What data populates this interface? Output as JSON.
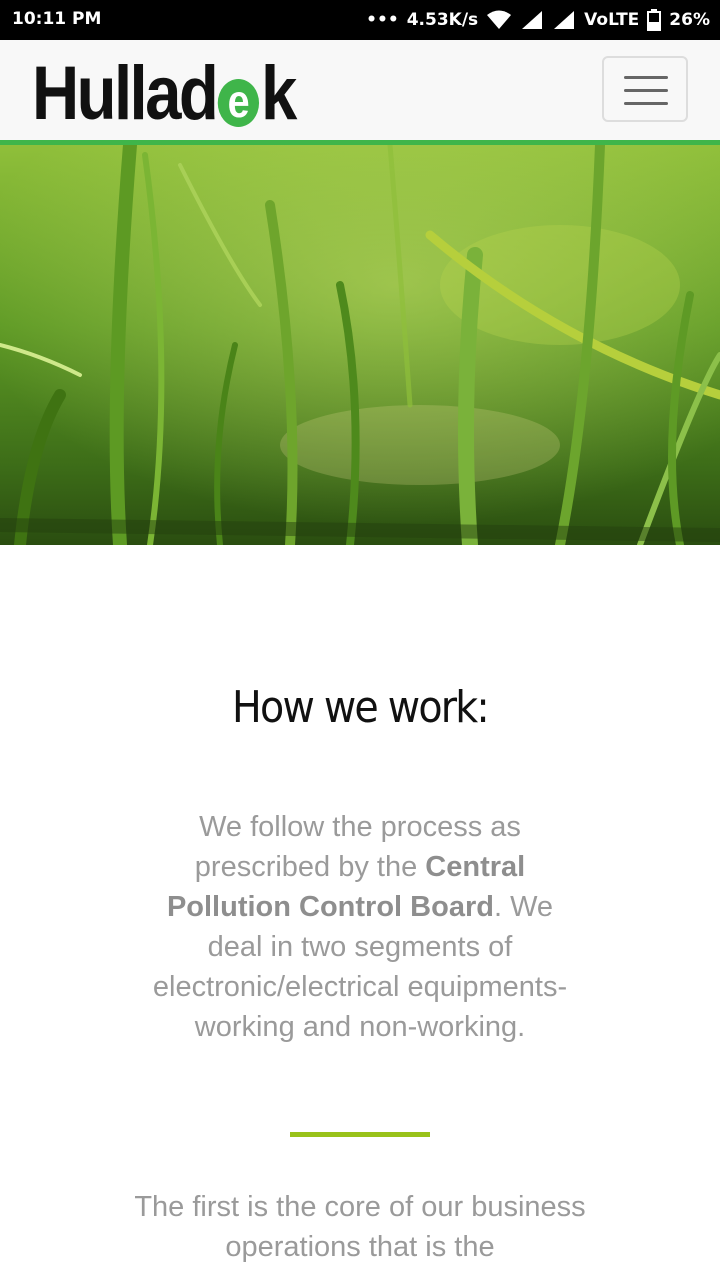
{
  "status_bar": {
    "time": "10:11 PM",
    "network_speed": "4.53K/s",
    "network_type": "VoLTE",
    "battery": "26%"
  },
  "header": {
    "logo_part1": "Hullad",
    "logo_e": "e",
    "logo_part2": "k",
    "menu_icon": "hamburger-menu-icon"
  },
  "hero": {
    "image": "grass-close-up-image"
  },
  "main": {
    "title": "How we work:",
    "paragraph1": {
      "text_a": "We follow the process as prescribed by the ",
      "bold": "Central Pollution Control Board",
      "text_b": ". We deal in two segments of electronic/electrical equipments- working and non-working."
    },
    "paragraph2": "The first is the core of our business operations that is the"
  },
  "colors": {
    "brand_green": "#3fb54a",
    "divider_green": "#99c21a",
    "text_gray": "#9a9a9a"
  }
}
